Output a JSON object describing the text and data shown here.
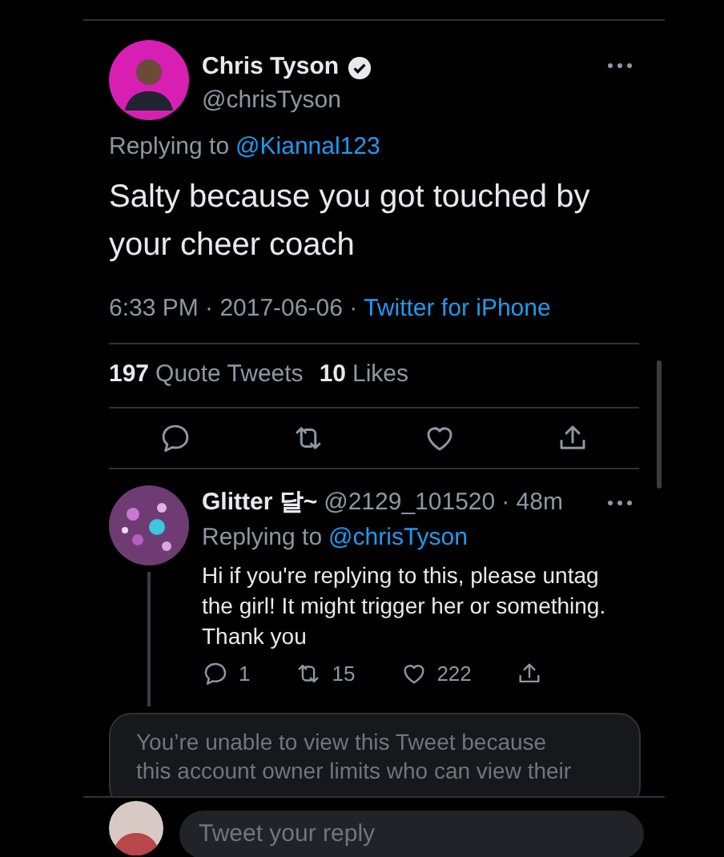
{
  "tweet": {
    "author": {
      "name": "Chris Tyson",
      "handle": "@chrisTyson",
      "verified": true
    },
    "replying_to": {
      "label": "Replying to",
      "handle": "@Kiannal123"
    },
    "text": "Salty because you got touched by your cheer coach",
    "timestamp": "6:33 PM · 2017-06-06 ·",
    "source": "Twitter for iPhone",
    "stats": [
      {
        "count": "197",
        "label": "Quote Tweets"
      },
      {
        "count": "10",
        "label": "Likes"
      }
    ],
    "actions": [
      {
        "kind": "reply"
      },
      {
        "kind": "retweet"
      },
      {
        "kind": "like"
      },
      {
        "kind": "share"
      }
    ]
  },
  "reply": {
    "author": {
      "name": "Glitter 달~",
      "handle": "@2129_101520",
      "time": "· 48m"
    },
    "replying_to": {
      "label": "Replying to",
      "handle": "@chrisTyson"
    },
    "text": "Hi if you're replying to this, please untag the girl! It might trigger her or something. Thank you",
    "actions": [
      {
        "kind": "reply",
        "count": "1"
      },
      {
        "kind": "retweet",
        "count": "15"
      },
      {
        "kind": "like",
        "count": "222"
      },
      {
        "kind": "share"
      }
    ]
  },
  "restricted_notice": {
    "lines": [
      "You’re unable to view this Tweet because",
      "this account owner limits who can view their"
    ]
  },
  "composer": {
    "placeholder": "Tweet your reply"
  }
}
